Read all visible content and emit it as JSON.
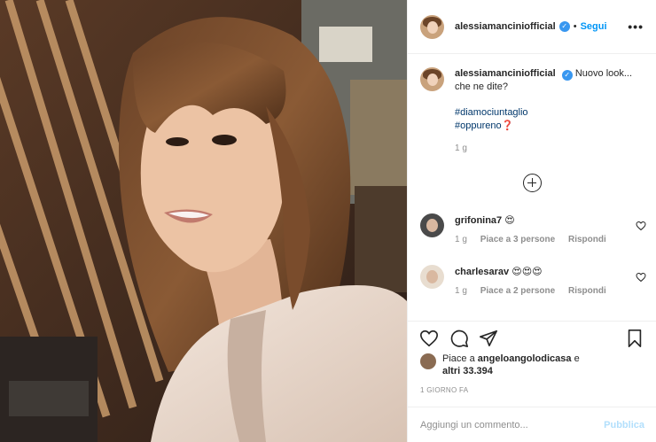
{
  "header": {
    "username": "alessiamanciniofficial",
    "dot": "•",
    "follow_label": "Segui",
    "more_label": "•••"
  },
  "caption": {
    "username": "alessiamanciniofficial",
    "text": "Nuovo look... che ne dite?",
    "hashtag1": "#diamociuntaglio",
    "hashtag2": "#oppureno",
    "question_mark": "❓",
    "time": "1 g"
  },
  "comments": [
    {
      "username": "grifonina7",
      "text": "😍",
      "time": "1 g",
      "likes": "Piace a 3 persone",
      "reply": "Rispondi"
    },
    {
      "username": "charlesarav",
      "text": "😍😍😍",
      "time": "1 g",
      "likes": "Piace a 2 persone",
      "reply": "Rispondi"
    }
  ],
  "likes": {
    "prefix": "Piace a",
    "user": "angeloangolodicasa",
    "middle": "e",
    "others": "altri 33.394"
  },
  "date": "1 GIORNO FA",
  "add_comment": {
    "placeholder": "Aggiungi un commento...",
    "publish": "Pubblica"
  },
  "colors": {
    "accent": "#0095f6",
    "verified": "#3897f0",
    "hashtag": "#00376b",
    "muted": "#8e8e8e"
  }
}
